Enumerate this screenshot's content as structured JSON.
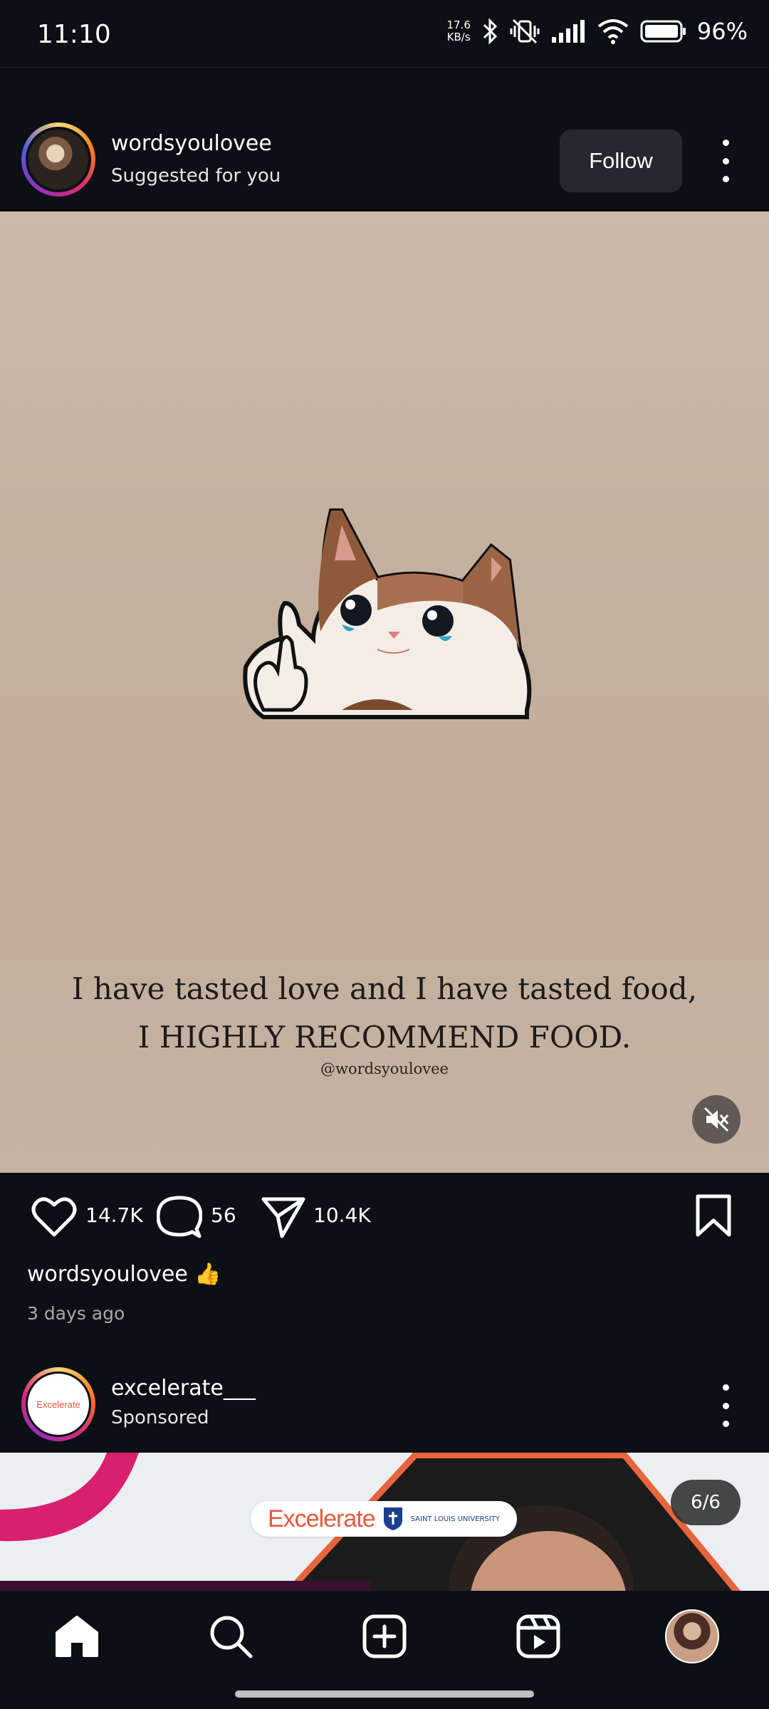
{
  "status_bar": {
    "time": "11:10",
    "network_speed_top": "17.6",
    "network_speed_unit": "KB/s",
    "battery": "96%"
  },
  "post": {
    "username": "wordsyoulovee",
    "subtitle": "Suggested for you",
    "follow_label": "Follow",
    "quote_line1": "I have tasted love and I have tasted food,",
    "quote_line2": "I HIGHLY RECOMMEND FOOD.",
    "watermark": "@wordsyoulovee",
    "likes": "14.7K",
    "comments": "56",
    "shares": "10.4K",
    "caption": "wordsyoulovee 👍",
    "posted": "3 days ago"
  },
  "sponsored_post": {
    "username": "excelerate___",
    "subtitle": "Sponsored",
    "logo_text": "Excelerate",
    "brand_text": "Excelerate",
    "partner_text": "SAINT LOUIS UNIVERSITY",
    "page_indicator": "6/6"
  },
  "nav": {
    "items": [
      "home-icon",
      "search-icon",
      "create-icon",
      "reels-icon",
      "profile-avatar"
    ]
  },
  "colors": {
    "background": "#0c1014",
    "media_bg": "#c4b09f",
    "follow_button": "#25292e",
    "brand_orange": "#e55a3c"
  }
}
